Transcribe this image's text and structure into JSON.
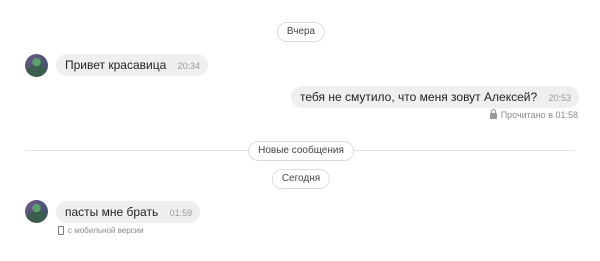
{
  "separators": {
    "yesterday": "Вчера",
    "new_messages": "Новые сообщения",
    "today": "Сегодня"
  },
  "messages": [
    {
      "text": "Привет красавица",
      "time": "20:34"
    },
    {
      "text": "тебя не смутило, что меня зовут Алексей?",
      "time": "20:53",
      "status": "Прочитано в 01:58"
    },
    {
      "text": "пасты мне брать",
      "time": "01:59",
      "sent_from": "с мобильной версии"
    }
  ]
}
